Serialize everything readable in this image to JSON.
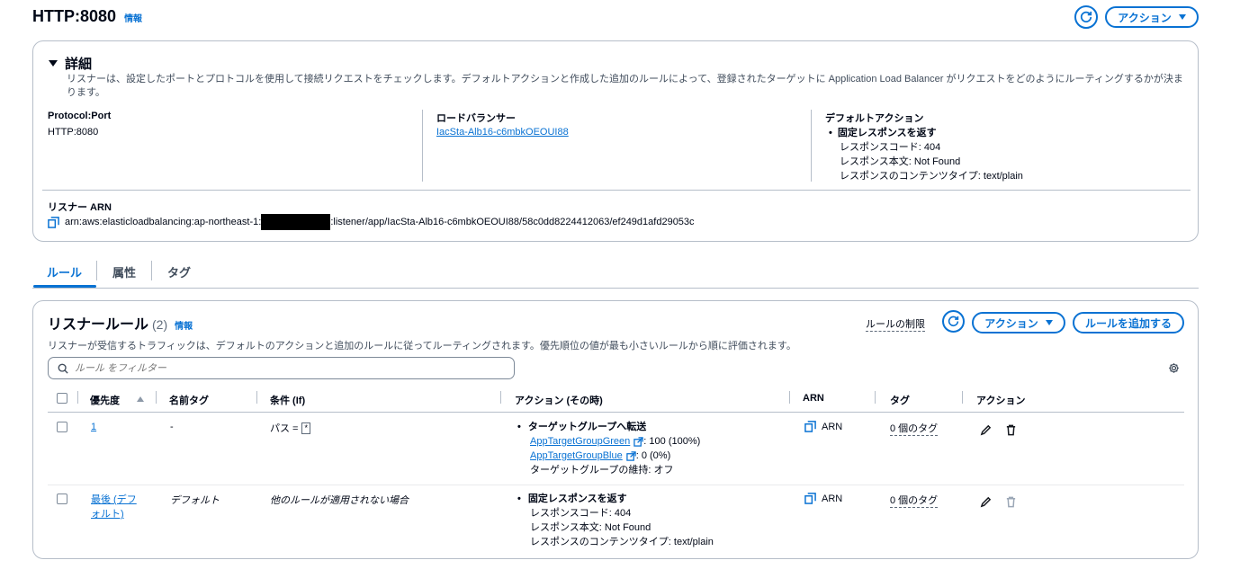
{
  "header": {
    "title": "HTTP:8080",
    "info": "情報",
    "actions_label": "アクション"
  },
  "details": {
    "heading": "詳細",
    "description": "リスナーは、設定したポートとプロトコルを使用して接続リクエストをチェックします。デフォルトアクションと作成した追加のルールによって、登録されたターゲットに Application Load Balancer がリクエストをどのようにルーティングするかが決まります。",
    "protocol_port_label": "Protocol:Port",
    "protocol_port_value": "HTTP:8080",
    "load_balancer_label": "ロードバランサー",
    "load_balancer_value": "IacSta-Alb16-c6mbkOEOUI88",
    "default_action_label": "デフォルトアクション",
    "default_action_title": "固定レスポンスを返す",
    "default_action_code": "レスポンスコード: 404",
    "default_action_body": "レスポンス本文: Not Found",
    "default_action_type": "レスポンスのコンテンツタイプ: text/plain",
    "arn_label": "リスナー ARN",
    "arn_prefix": "arn:aws:elasticloadbalancing:ap-northeast-1:",
    "arn_suffix": ":listener/app/IacSta-Alb16-c6mbkOEOUI88/58c0dd8224412063/ef249d1afd29053c"
  },
  "tabs": [
    {
      "label": "ルール"
    },
    {
      "label": "属性"
    },
    {
      "label": "タグ"
    }
  ],
  "rules": {
    "title": "リスナールール",
    "count": "(2)",
    "info": "情報",
    "limits_label": "ルールの制限",
    "actions_label": "アクション",
    "add_rule_label": "ルールを追加する",
    "description": "リスナーが受信するトラフィックは、デフォルトのアクションと追加のルールに従ってルーティングされます。優先順位の値が最も小さいルールから順に評価されます。",
    "filter_placeholder": "ルール をフィルター",
    "columns": {
      "priority": "優先度",
      "name_tag": "名前タグ",
      "condition": "条件 (If)",
      "action": "アクション (その時)",
      "arn": "ARN",
      "tags": "タグ",
      "actions": "アクション"
    },
    "rows": [
      {
        "priority": "1",
        "name_tag": "-",
        "condition": "パス =",
        "condition_value": "*",
        "action_title": "ターゲットグループへ転送",
        "tg1_name": "AppTargetGroupGreen",
        "tg1_weight": ": 100 (100%)",
        "tg2_name": "AppTargetGroupBlue",
        "tg2_weight": ": 0 (0%)",
        "stickiness": "ターゲットグループの維持: オフ",
        "arn": "ARN",
        "tags": "0 個のタグ"
      },
      {
        "priority": "最後 (デフォルト)",
        "name_tag": "デフォルト",
        "condition": "他のルールが適用されない場合",
        "action_title": "固定レスポンスを返す",
        "code": "レスポンスコード: 404",
        "body": "レスポンス本文: Not Found",
        "type": "レスポンスのコンテンツタイプ: text/plain",
        "arn": "ARN",
        "tags": "0 個のタグ"
      }
    ]
  }
}
